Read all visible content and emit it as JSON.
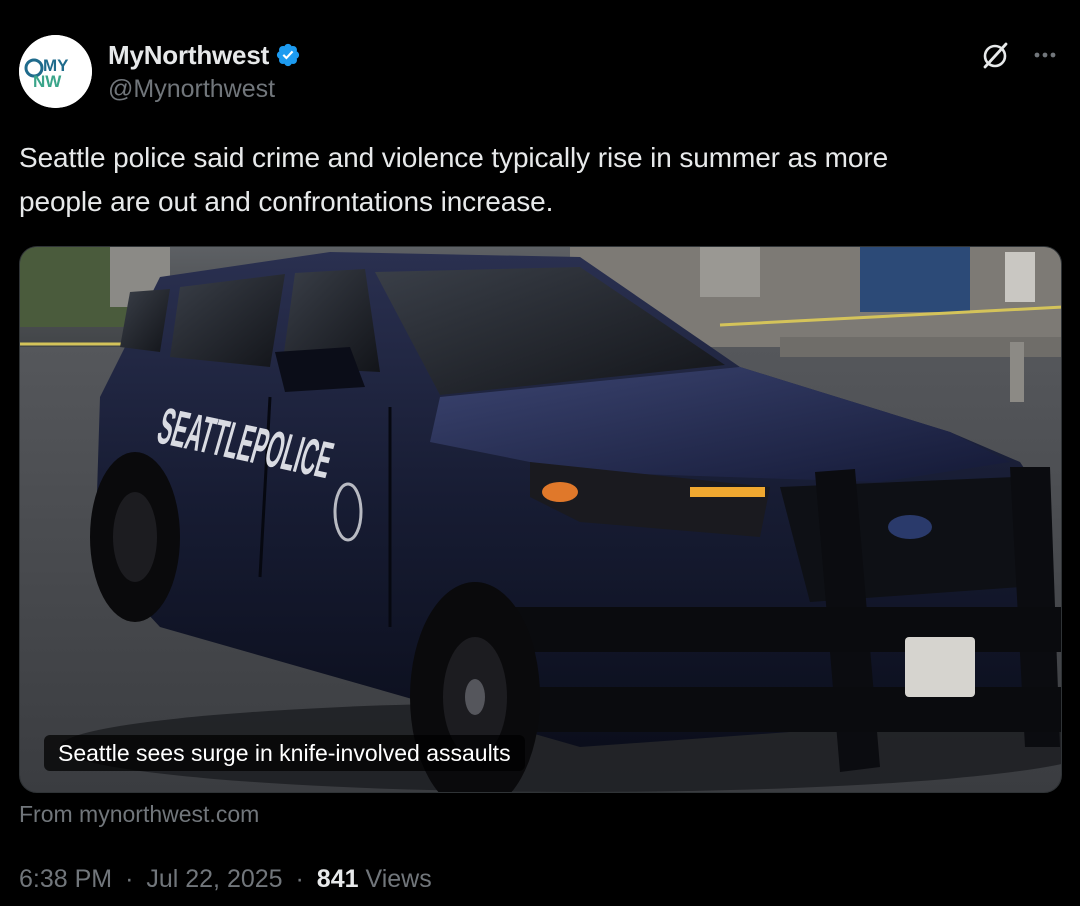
{
  "author": {
    "display_name": "MyNorthwest",
    "handle": "@Mynorthwest",
    "verified": true,
    "avatar_logo_text": "MYNW"
  },
  "header_actions": {
    "grok_icon": "grok-slash-icon",
    "more_icon": "more-dots-icon"
  },
  "tweet": {
    "text_line1": "Seattle police said crime and violence typically rise in summer as more",
    "text_line2": "people are out and confrontations increase."
  },
  "card": {
    "title": "Seattle sees surge in knife-involved assaults",
    "source": "From mynorthwest.com",
    "image_vehicle_text": "SEATTLEPOLICE"
  },
  "meta": {
    "time": "6:38 PM",
    "separator": "·",
    "date": "Jul 22, 2025",
    "views_count": "841",
    "views_label": "Views"
  },
  "colors": {
    "background": "#000000",
    "text_primary": "#e7e9ea",
    "text_secondary": "#71767b",
    "verified_blue": "#1d9bf0"
  }
}
